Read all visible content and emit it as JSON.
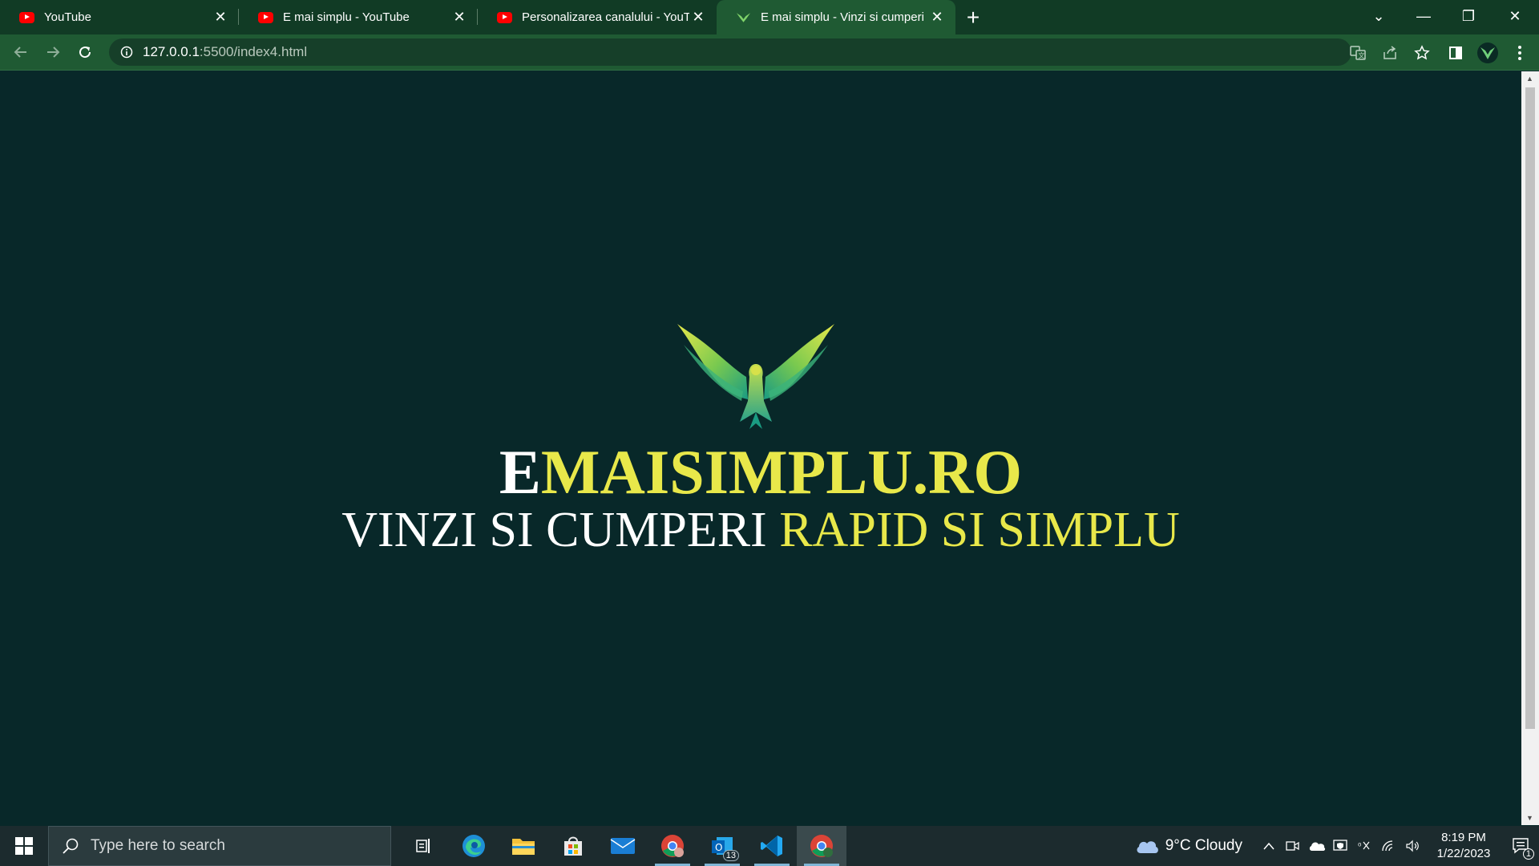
{
  "browser": {
    "tabs": [
      {
        "title": "YouTube",
        "favicon": "youtube-icon",
        "active": false
      },
      {
        "title": "E mai simplu - YouTube",
        "favicon": "youtube-icon",
        "active": false
      },
      {
        "title": "Personalizarea canalului - YouTube",
        "favicon": "youtube-icon",
        "active": false
      },
      {
        "title": "E mai simplu - Vinzi si cumperi rapid si simplu",
        "favicon": "bird-logo-icon",
        "active": true
      }
    ],
    "address": {
      "host": "127.0.0.1",
      "path": ":5500/index4.html"
    }
  },
  "page": {
    "brand_first": "E",
    "brand_rest": "MAISIMPLU.RO",
    "tagline_white": "VINZI SI CUMPERI ",
    "tagline_yellow": "RAPID SI SIMPLU",
    "colors": {
      "background": "#082829",
      "accent": "#e8e84a",
      "text": "#ffffff"
    }
  },
  "taskbar": {
    "search_placeholder": "Type here to search",
    "weather": "9°C  Cloudy",
    "time": "8:19 PM",
    "date": "1/22/2023",
    "outlook_badge": "13",
    "notification_count": "1"
  }
}
